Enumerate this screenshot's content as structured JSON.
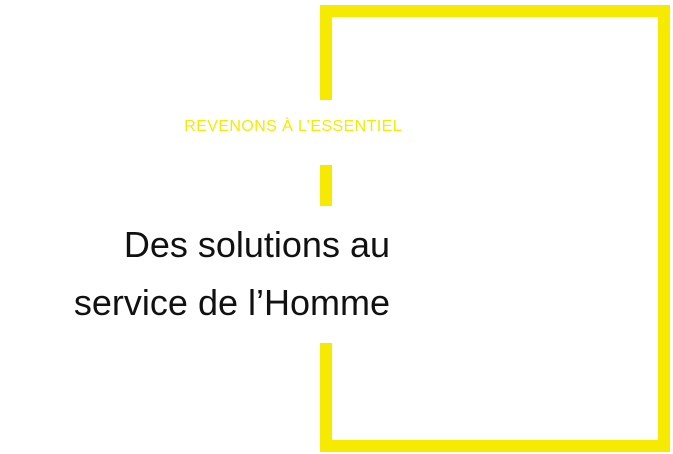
{
  "hero": {
    "eyebrow": "REVENONS À L’ESSENTIEL",
    "headline_line1": "Des solutions au",
    "headline_line2": "service de l’Homme"
  },
  "colors": {
    "accent": "#f5ea00",
    "text": "#111111",
    "background": "#ffffff"
  }
}
